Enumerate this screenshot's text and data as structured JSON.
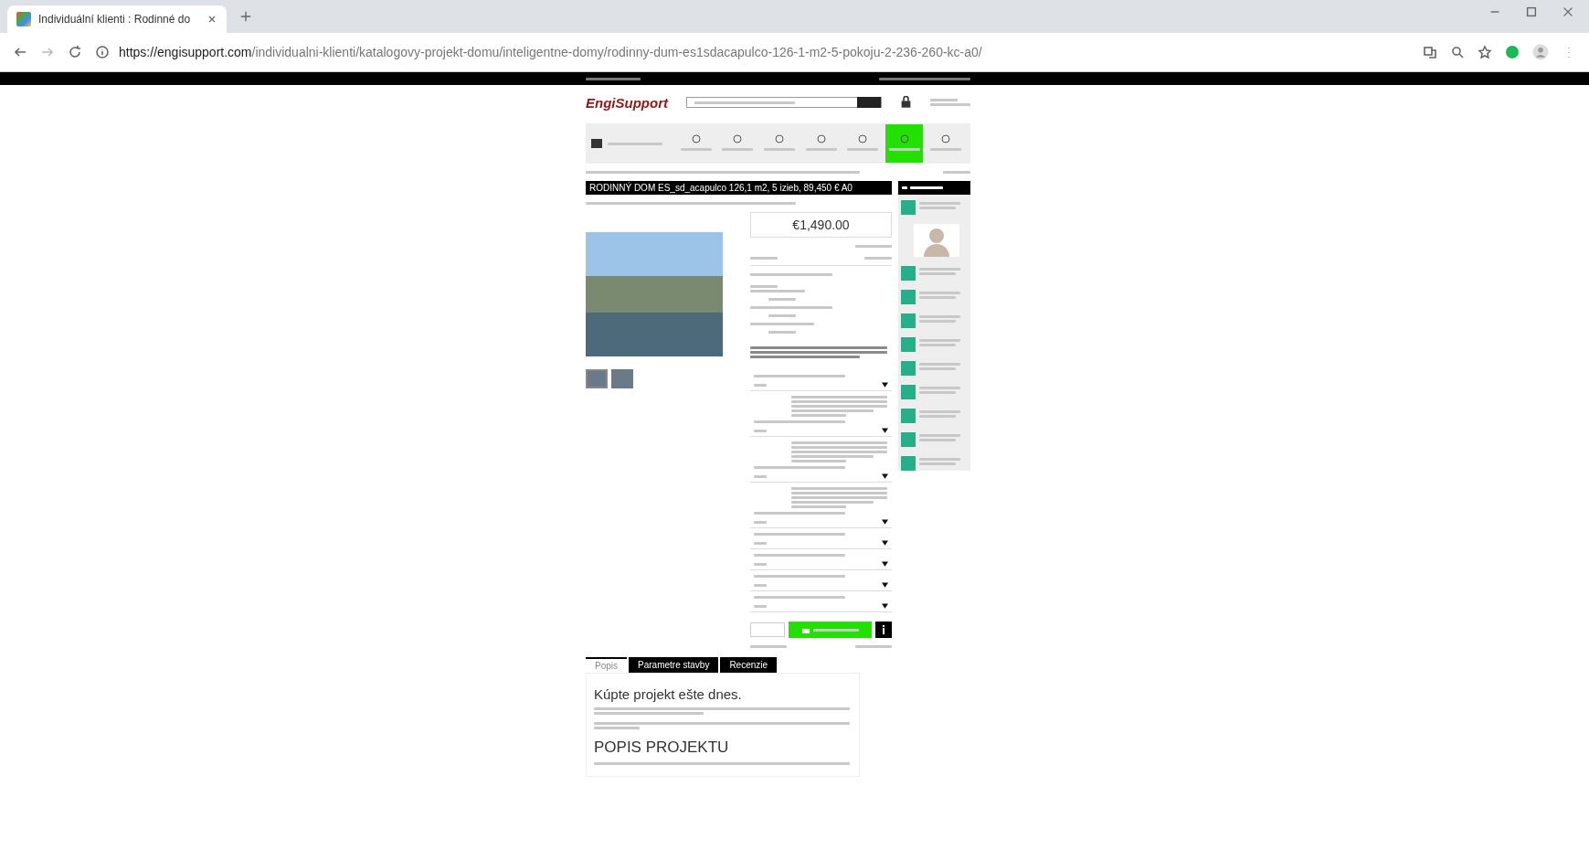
{
  "browser": {
    "tab_title": "Individuální klienti : Rodinné do",
    "url_host": "https://engisupport.com",
    "url_path": "/individualni-klienti/katalogovy-projekt-domu/inteligentne-domy/rodinny-dum-es1sdacapulco-126-1-m2-5-pokoju-2-236-260-kc-a0/"
  },
  "site": {
    "logo": "EngiSupport",
    "nav_items": [
      {
        "selected": false
      },
      {
        "selected": false
      },
      {
        "selected": false
      },
      {
        "selected": false
      },
      {
        "selected": false
      },
      {
        "selected": true
      },
      {
        "selected": false
      }
    ]
  },
  "product": {
    "title": "RODINNÝ DOM ES_sd_acapulco 126,1 m2, 5 izieb, 89,450 € A0",
    "price": "€1,490.00",
    "thumbnails": [
      {
        "selected": true
      },
      {
        "selected": false
      }
    ],
    "options": [
      {
        "kind": "with-note"
      },
      {
        "kind": "with-note"
      },
      {
        "kind": "with-note"
      },
      {
        "kind": "plain"
      },
      {
        "kind": "plain"
      },
      {
        "kind": "plain"
      },
      {
        "kind": "plain"
      },
      {
        "kind": "plain"
      }
    ]
  },
  "sidebar": {
    "items": [
      {
        "kind": "link"
      },
      {
        "kind": "photo"
      },
      {
        "kind": "link"
      },
      {
        "kind": "link"
      },
      {
        "kind": "link"
      },
      {
        "kind": "link"
      },
      {
        "kind": "link"
      },
      {
        "kind": "link"
      },
      {
        "kind": "link"
      },
      {
        "kind": "link"
      },
      {
        "kind": "link"
      }
    ]
  },
  "description_tabs": [
    {
      "label": "Popis",
      "selected": true
    },
    {
      "label": "Parametre stavby",
      "selected": false
    },
    {
      "label": "Recenzie",
      "selected": false
    }
  ],
  "description": {
    "heading": "Kúpte projekt ešte dnes.",
    "section_title": "POPIS PROJEKTU"
  }
}
